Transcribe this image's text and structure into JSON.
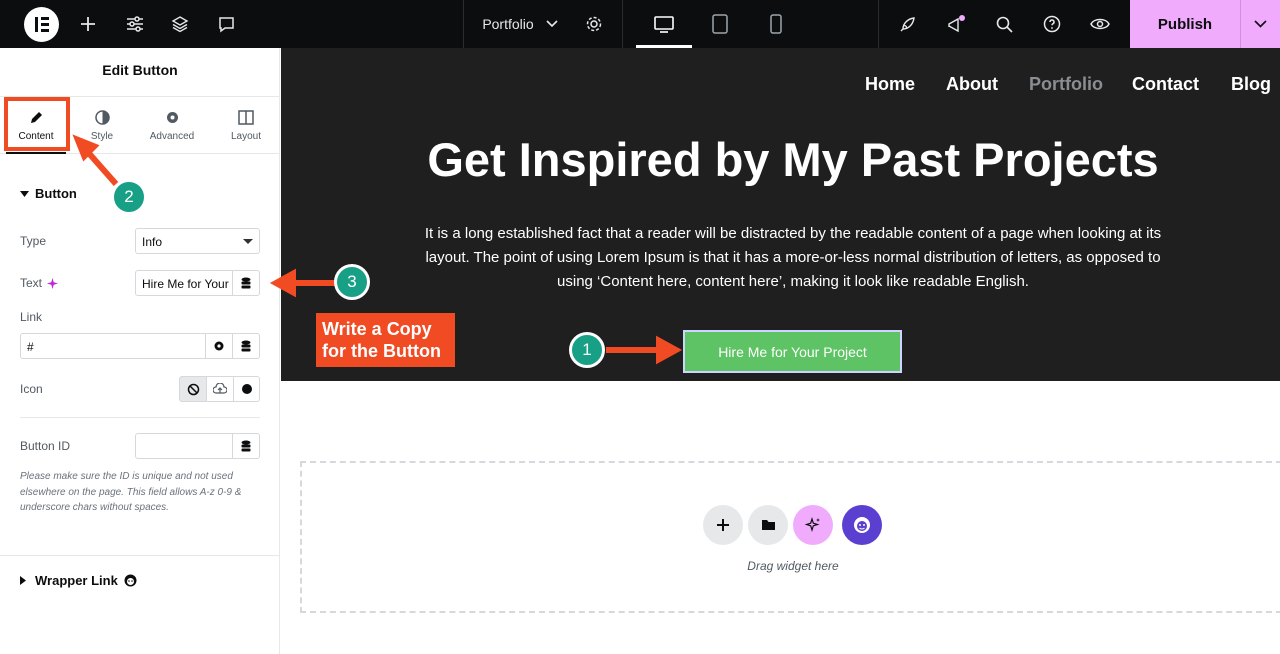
{
  "topbar": {
    "page_name": "Portfolio",
    "publish_label": "Publish"
  },
  "panel": {
    "title": "Edit Button",
    "tabs": [
      {
        "label": "Content"
      },
      {
        "label": "Style"
      },
      {
        "label": "Advanced"
      },
      {
        "label": "Layout"
      }
    ],
    "section_button": "Button",
    "type_label": "Type",
    "type_value": "Info",
    "text_label": "Text",
    "text_value": "Hire Me for Your",
    "link_label": "Link",
    "link_value": "#",
    "icon_label": "Icon",
    "button_id_label": "Button ID",
    "button_id_value": "",
    "note": "Please make sure the ID is unique and not used elsewhere on the page. This field allows A-z  0-9 & underscore chars without spaces.",
    "wrapper_link": "Wrapper Link"
  },
  "canvas": {
    "nav": [
      "Home",
      "About",
      "Portfolio",
      "Contact",
      "Blog"
    ],
    "hero_title": "Get Inspired by My Past Projects",
    "hero_text": "It is a long established fact that a reader will be distracted by the readable content of a page when looking at its layout. The point of using Lorem Ipsum is that it has a more-or-less normal distribution of letters, as opposed to using ‘Content here, content here’, making it look like readable English.",
    "button_label": "Hire Me for Your Project",
    "drag_label": "Drag widget here"
  },
  "annotations": {
    "step1": "1",
    "step2": "2",
    "step3": "3",
    "callout": "Write a Copy for the Button"
  },
  "colors": {
    "accent_publish": "#f0abfc",
    "button_green": "#5ec364",
    "annotation_red": "#f04b23",
    "badge_teal": "#17a085"
  }
}
